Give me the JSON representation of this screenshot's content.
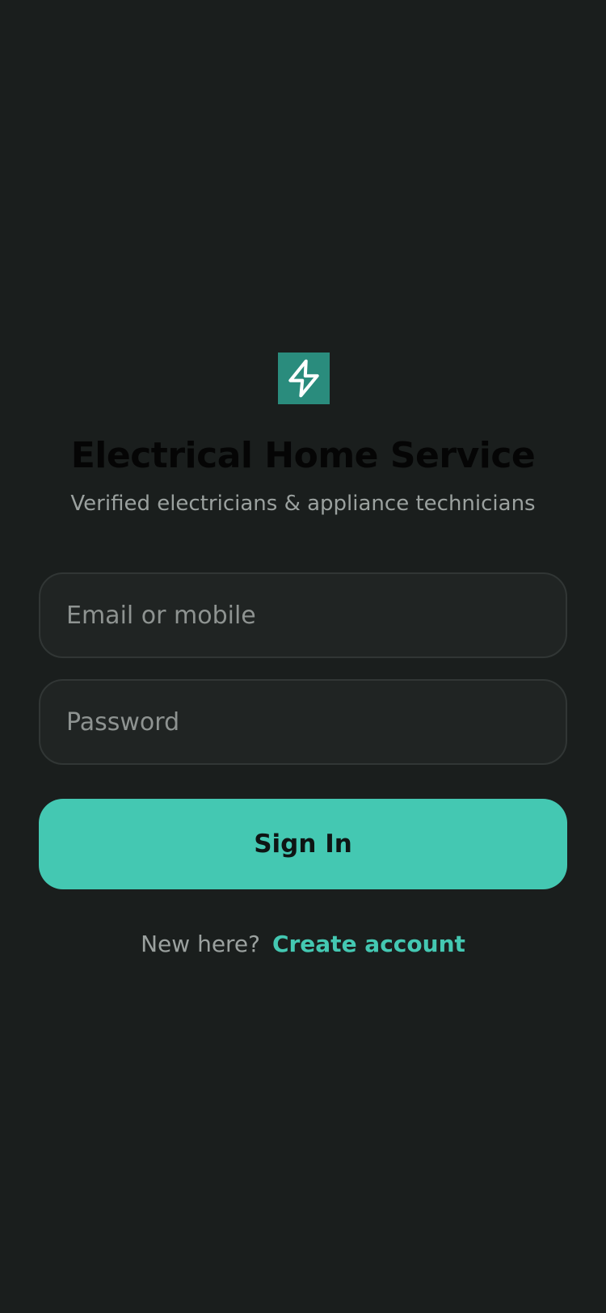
{
  "app": {
    "logo_icon": "lightning-bolt-icon",
    "title": "Electrical Home Service",
    "subtitle": "Verified electricians & appliance technicians"
  },
  "form": {
    "email": {
      "value": "",
      "placeholder": "Email or mobile"
    },
    "password": {
      "value": "",
      "placeholder": "Password"
    },
    "submit_label": "Sign In"
  },
  "footer": {
    "prompt": "New here?",
    "link_label": "Create account"
  },
  "colors": {
    "background": "#1a1e1d",
    "accent": "#44c8b2",
    "logo_background": "#2a8c7d",
    "field_background": "#202423",
    "field_border": "#313635",
    "muted_text": "#9ba19f"
  }
}
